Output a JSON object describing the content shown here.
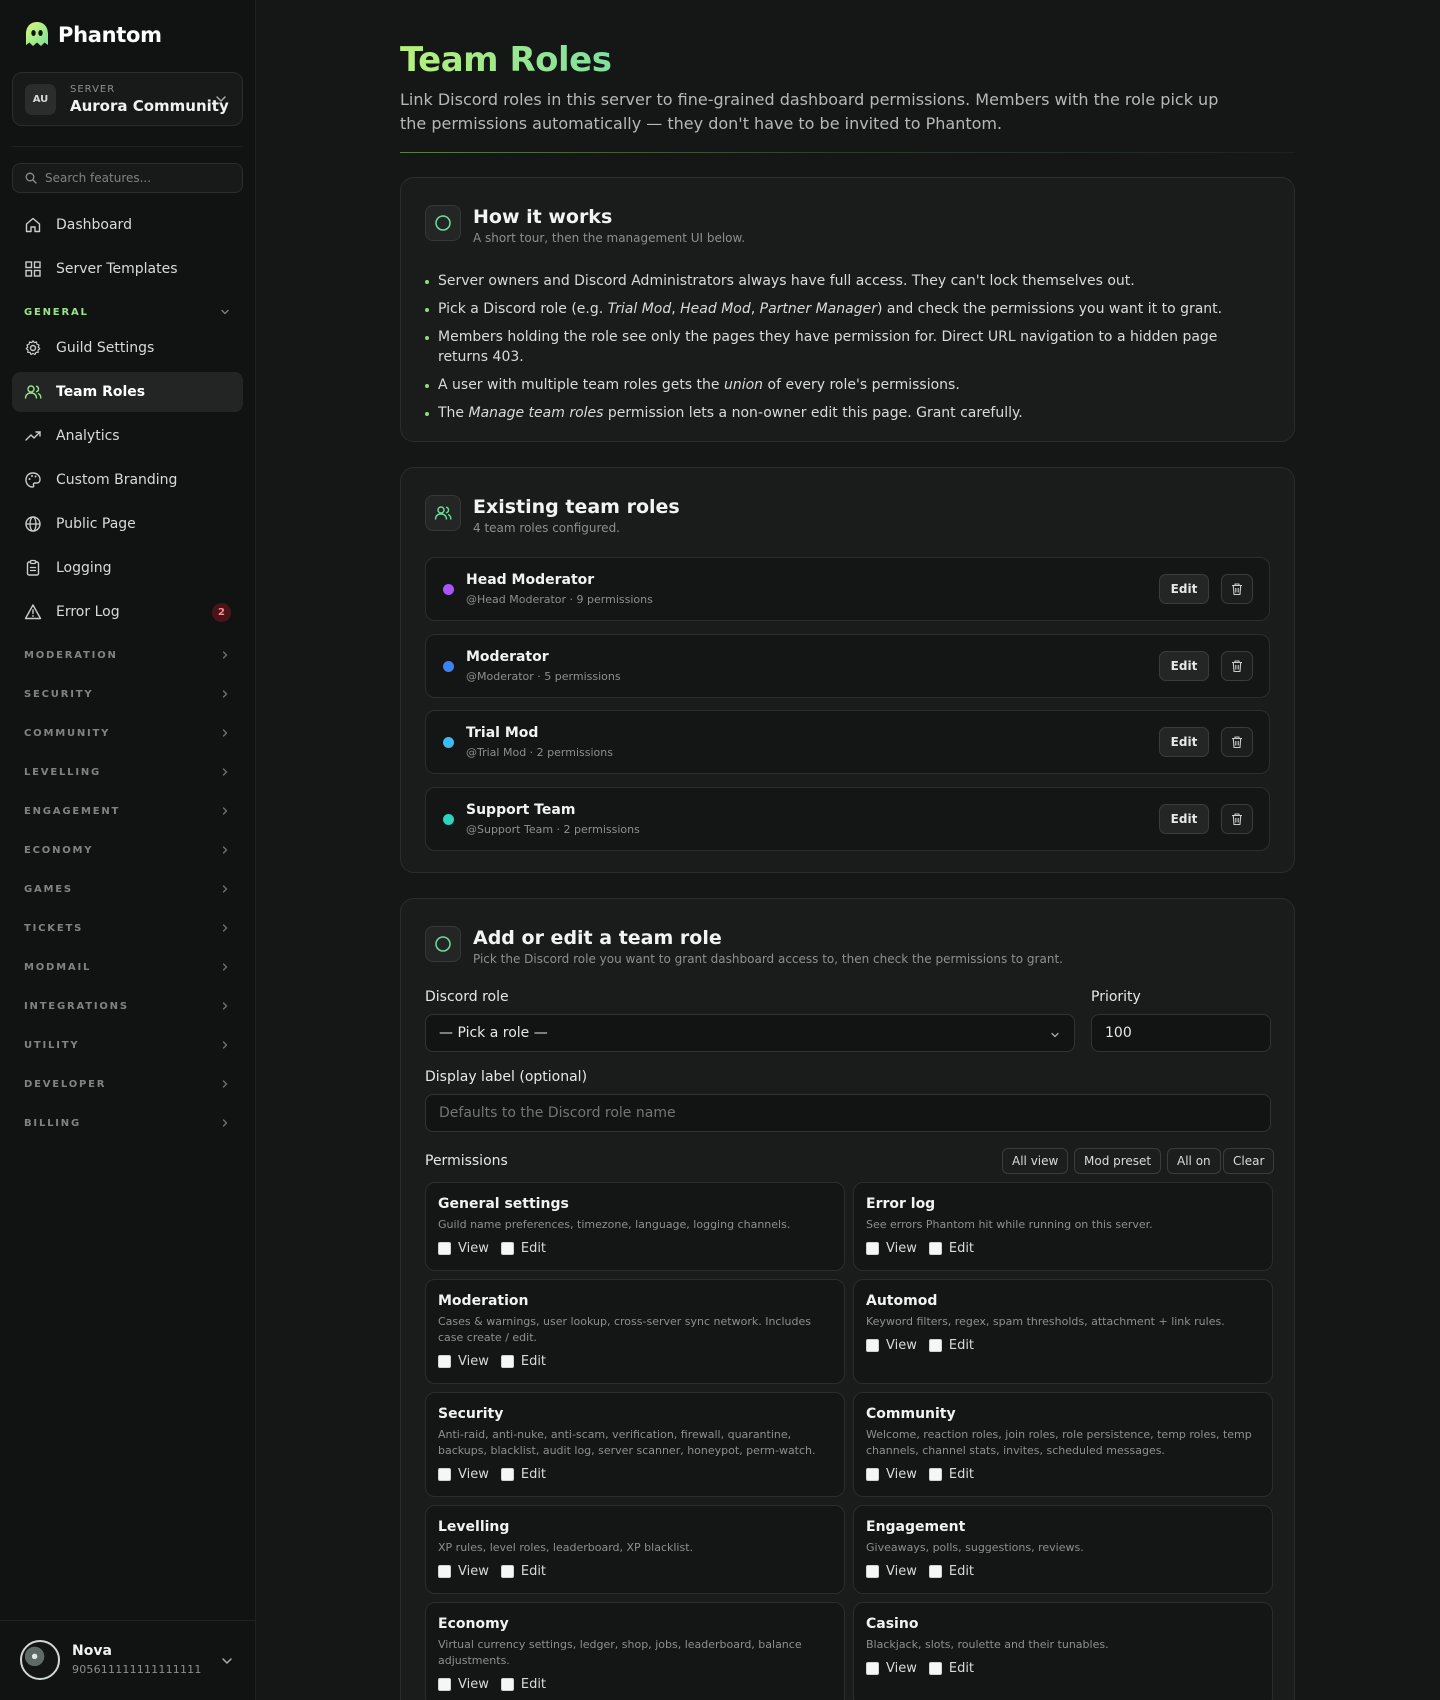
{
  "app": {
    "brand": "Phantom",
    "server_kicker": "SERVER",
    "server_name": "Aurora Community",
    "server_initials": "AU",
    "search_placeholder": "Search features..."
  },
  "nav": {
    "dashboard": "Dashboard",
    "templates": "Server Templates",
    "general_section": "GENERAL",
    "guild_settings": "Guild Settings",
    "team_roles": "Team Roles",
    "analytics": "Analytics",
    "custom_branding": "Custom Branding",
    "public_page": "Public Page",
    "logging": "Logging",
    "error_log": "Error Log",
    "error_count": "2",
    "sections": [
      "MODERATION",
      "SECURITY",
      "COMMUNITY",
      "LEVELLING",
      "ENGAGEMENT",
      "ECONOMY",
      "GAMES",
      "TICKETS",
      "MODMAIL",
      "INTEGRATIONS",
      "UTILITY",
      "DEVELOPER",
      "BILLING"
    ]
  },
  "user": {
    "name": "Nova",
    "id": "905611111111111111"
  },
  "page": {
    "title": "Team Roles",
    "subtitle": "Link Discord roles in this server to fine-grained dashboard permissions. Members with the role pick up the permissions automatically — they don't have to be invited to Phantom."
  },
  "how": {
    "title": "How it works",
    "subtitle": "A short tour, then the management UI below."
  },
  "existing": {
    "title": "Existing team roles",
    "subtitle": "4 team roles configured.",
    "edit_label": "Edit",
    "roles": [
      {
        "name": "Head Moderator",
        "meta": "@Head Moderator · 9 permissions",
        "color": "#a855f7"
      },
      {
        "name": "Moderator",
        "meta": "@Moderator · 5 permissions",
        "color": "#3b82f6"
      },
      {
        "name": "Trial Mod",
        "meta": "@Trial Mod · 2 permissions",
        "color": "#38bdf8"
      },
      {
        "name": "Support Team",
        "meta": "@Support Team · 2 permissions",
        "color": "#2dd4bf"
      }
    ]
  },
  "editor": {
    "title": "Add or edit a team role",
    "subtitle": "Pick the Discord role you want to grant dashboard access to, then check the permissions to grant.",
    "discord_role_label": "Discord role",
    "discord_role_value": "— Pick a role —",
    "priority_label": "Priority",
    "priority_value": "100",
    "display_label": "Display label (optional)",
    "display_placeholder": "Defaults to the Discord role name",
    "permissions_label": "Permissions",
    "buttons": [
      "All view",
      "Mod preset",
      "All on",
      "Clear"
    ],
    "view_label": "View",
    "edit_label": "Edit",
    "perms": [
      {
        "title": "General settings",
        "desc": "Guild name preferences, timezone, language, logging channels."
      },
      {
        "title": "Error log",
        "desc": "See errors Phantom hit while running on this server."
      },
      {
        "title": "Moderation",
        "desc": "Cases & warnings, user lookup, cross-server sync network. Includes case create / edit."
      },
      {
        "title": "Automod",
        "desc": "Keyword filters, regex, spam thresholds, attachment + link rules."
      },
      {
        "title": "Security",
        "desc": "Anti-raid, anti-nuke, anti-scam, verification, firewall, quarantine, backups, blacklist, audit log, server scanner, honeypot, perm-watch."
      },
      {
        "title": "Community",
        "desc": "Welcome, reaction roles, join roles, role persistence, temp roles, temp channels, channel stats, invites, scheduled messages."
      },
      {
        "title": "Levelling",
        "desc": "XP rules, level roles, leaderboard, XP blacklist."
      },
      {
        "title": "Engagement",
        "desc": "Giveaways, polls, suggestions, reviews."
      },
      {
        "title": "Economy",
        "desc": "Virtual currency settings, ledger, shop, jobs, leaderboard, balance adjustments."
      },
      {
        "title": "Casino",
        "desc": "Blackjack, slots, roulette and their tunables."
      }
    ]
  }
}
